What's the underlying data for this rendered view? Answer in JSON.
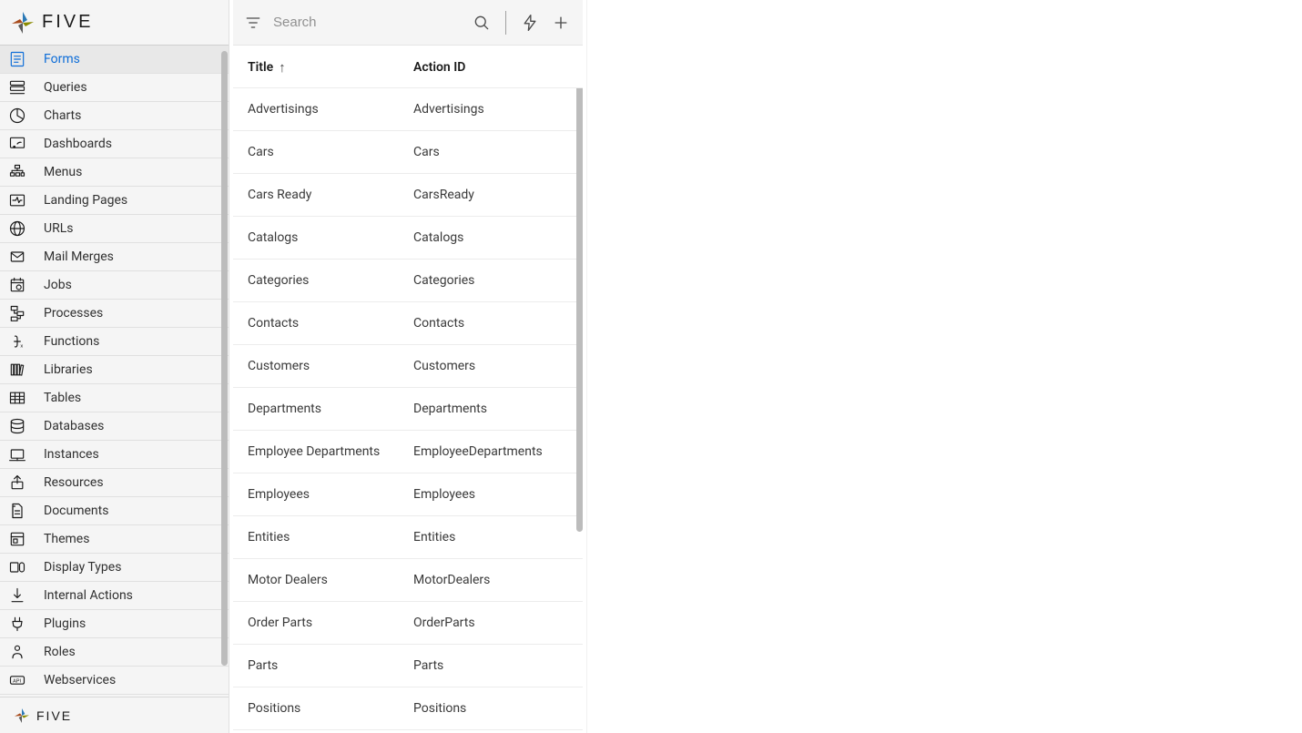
{
  "brand": {
    "name": "FIVE",
    "footer": "FIVE"
  },
  "sidebar": {
    "items": [
      {
        "label": "Forms",
        "icon": "form-icon",
        "active": true
      },
      {
        "label": "Queries",
        "icon": "queries-icon"
      },
      {
        "label": "Charts",
        "icon": "charts-icon"
      },
      {
        "label": "Dashboards",
        "icon": "dashboards-icon"
      },
      {
        "label": "Menus",
        "icon": "menus-icon"
      },
      {
        "label": "Landing Pages",
        "icon": "landing-pages-icon"
      },
      {
        "label": "URLs",
        "icon": "urls-icon"
      },
      {
        "label": "Mail Merges",
        "icon": "mail-merges-icon"
      },
      {
        "label": "Jobs",
        "icon": "jobs-icon"
      },
      {
        "label": "Processes",
        "icon": "processes-icon"
      },
      {
        "label": "Functions",
        "icon": "functions-icon"
      },
      {
        "label": "Libraries",
        "icon": "libraries-icon"
      },
      {
        "label": "Tables",
        "icon": "tables-icon"
      },
      {
        "label": "Databases",
        "icon": "databases-icon"
      },
      {
        "label": "Instances",
        "icon": "instances-icon"
      },
      {
        "label": "Resources",
        "icon": "resources-icon"
      },
      {
        "label": "Documents",
        "icon": "documents-icon"
      },
      {
        "label": "Themes",
        "icon": "themes-icon"
      },
      {
        "label": "Display Types",
        "icon": "display-types-icon"
      },
      {
        "label": "Internal Actions",
        "icon": "internal-actions-icon"
      },
      {
        "label": "Plugins",
        "icon": "plugins-icon"
      },
      {
        "label": "Roles",
        "icon": "roles-icon"
      },
      {
        "label": "Webservices",
        "icon": "webservices-icon"
      }
    ]
  },
  "toolbar": {
    "search_placeholder": "Search"
  },
  "table": {
    "columns": {
      "title": "Title",
      "action_id": "Action ID"
    },
    "sort": {
      "column": "title",
      "direction": "asc",
      "arrow": "↑"
    },
    "rows": [
      {
        "title": "Advertisings",
        "action_id": "Advertisings"
      },
      {
        "title": "Cars",
        "action_id": "Cars"
      },
      {
        "title": "Cars Ready",
        "action_id": "CarsReady"
      },
      {
        "title": "Catalogs",
        "action_id": "Catalogs"
      },
      {
        "title": "Categories",
        "action_id": "Categories"
      },
      {
        "title": "Contacts",
        "action_id": "Contacts"
      },
      {
        "title": "Customers",
        "action_id": "Customers"
      },
      {
        "title": "Departments",
        "action_id": "Departments"
      },
      {
        "title": "Employee Departments",
        "action_id": "EmployeeDepartments"
      },
      {
        "title": "Employees",
        "action_id": "Employees"
      },
      {
        "title": "Entities",
        "action_id": "Entities"
      },
      {
        "title": "Motor Dealers",
        "action_id": "MotorDealers"
      },
      {
        "title": "Order Parts",
        "action_id": "OrderParts"
      },
      {
        "title": "Parts",
        "action_id": "Parts"
      },
      {
        "title": "Positions",
        "action_id": "Positions"
      }
    ]
  }
}
